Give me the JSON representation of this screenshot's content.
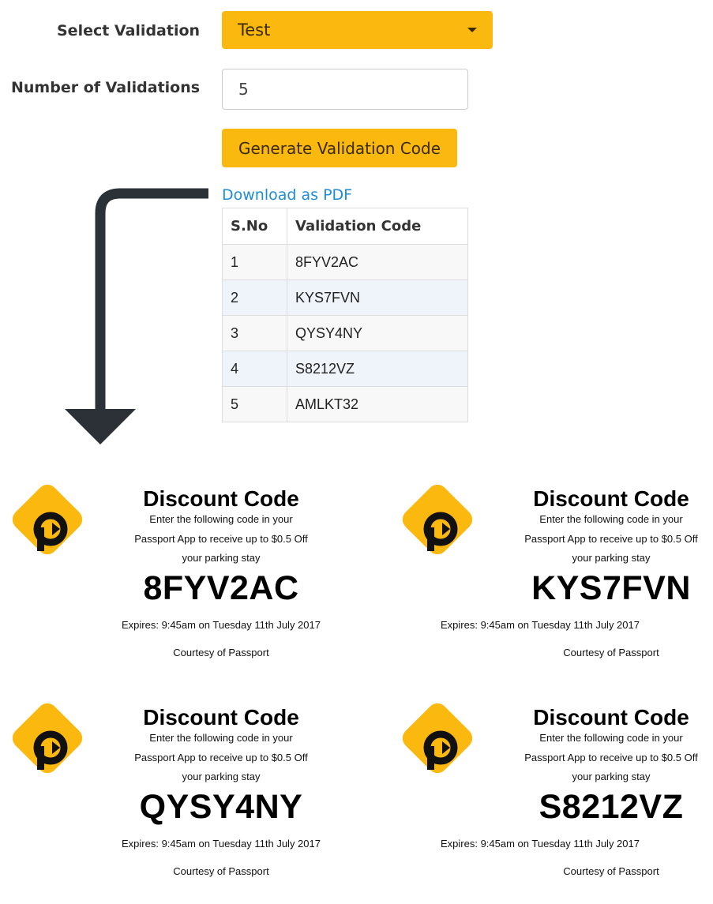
{
  "form": {
    "select_label": "Select Validation",
    "select_value": "Test",
    "number_label": "Number of Validations",
    "number_value": "5",
    "generate_button": "Generate Validation Code",
    "download_link": "Download as PDF"
  },
  "table": {
    "headers": [
      "S.No",
      "Validation Code"
    ],
    "rows": [
      [
        "1",
        "8FYV2AC"
      ],
      [
        "2",
        "KYS7FVN"
      ],
      [
        "3",
        "QYSY4NY"
      ],
      [
        "4",
        "S8212VZ"
      ],
      [
        "5",
        "AMLKT32"
      ]
    ]
  },
  "coupons": [
    {
      "title": "Discount Code",
      "line1": "Enter the following code in your",
      "line2": "Passport App to receive up to $0.5 Off",
      "line3": "your parking stay",
      "code": "8FYV2AC",
      "expires": "Expires: 9:45am on Tuesday 11th July 2017",
      "courtesy": "Courtesy of Passport"
    },
    {
      "title": "Discount Code",
      "line1": "Enter the following code in your",
      "line2": "Passport App to receive up to $0.5 Off",
      "line3": "your parking stay",
      "code": "KYS7FVN",
      "expires": "Expires: 9:45am on Tuesday 11th July 2017",
      "courtesy": "Courtesy of Passport"
    },
    {
      "title": "Discount Code",
      "line1": "Enter the following code in your",
      "line2": "Passport App to receive up to $0.5 Off",
      "line3": "your parking stay",
      "code": "QYSY4NY",
      "expires": "Expires: 9:45am on Tuesday 11th July 2017",
      "courtesy": "Courtesy of Passport"
    },
    {
      "title": "Discount Code",
      "line1": "Enter the following code in your",
      "line2": "Passport App to receive up to $0.5 Off",
      "line3": "your parking stay",
      "code": "S8212VZ",
      "expires": "Expires: 9:45am on Tuesday 11th July 2017",
      "courtesy": "Courtesy of Passport"
    }
  ],
  "colors": {
    "accent": "#fbb80f",
    "link": "#1f8dd6",
    "arrow": "#2c3138"
  },
  "icons": {
    "dropdown": "chevron-down-icon",
    "arrow": "arrow-down-icon",
    "logo": "passport-logo-icon"
  }
}
